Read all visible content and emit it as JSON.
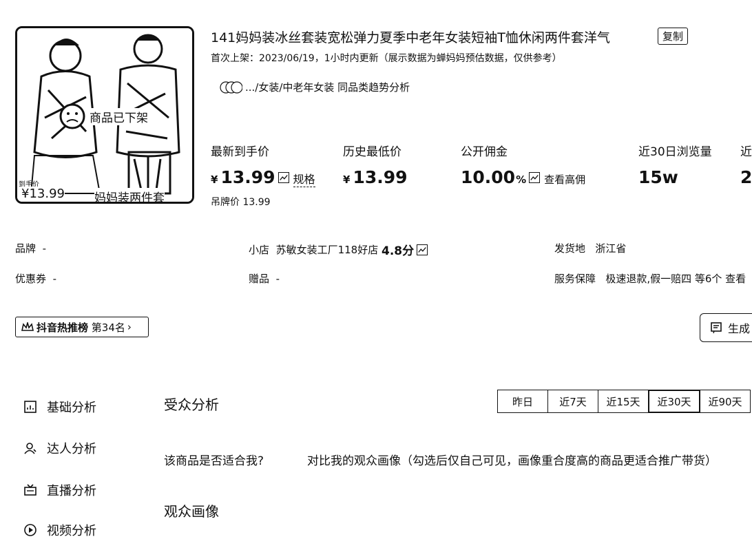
{
  "product": {
    "title": "141妈妈装冰丝套装宽松弹力夏季中老年女装短袖T恤休闲两件套洋气",
    "copy_label": "复制",
    "first_listed": "首次上架：2023/06/19，1小时内更新（展示数据为蝉妈妈预估数据，仅供参考）",
    "category": ".../女装/中老年女装 同品类趋势分析",
    "thumbnail": {
      "status_overlay": "商品已下架",
      "price_overlay": "¥13.99",
      "caption_overlay": "妈妈装两件套",
      "price_tag": "到手价"
    }
  },
  "stats": {
    "latest_price_label": "最新到手价",
    "latest_price_currency": "¥",
    "latest_price_value": "13.99",
    "spec_label": "规格",
    "tag_price": "吊牌价 13.99",
    "lowest_price_label": "历史最低价",
    "lowest_price_currency": "¥",
    "lowest_price_value": "13.99",
    "commission_label": "公开佣金",
    "commission_value": "10.00",
    "commission_unit": "%",
    "view_commission_label": "查看高佣",
    "views_label": "近30日浏览量",
    "views_value": "15w",
    "extra_label": "近",
    "extra_value": "2"
  },
  "info": {
    "brand_label": "品牌",
    "brand_value": "-",
    "shop_label": "小店",
    "shop_name": "苏敏女装工厂118好店",
    "shop_score": "4.8分",
    "ship_label": "发货地",
    "ship_value": "浙江省",
    "coupon_label": "优惠券",
    "coupon_value": "-",
    "gift_label": "赠品",
    "gift_value": "-",
    "service_label": "服务保障",
    "service_value": "极速退款,假一赔四 等6个 查看"
  },
  "rank": {
    "label": "抖音热推榜",
    "position": "第34名",
    "arrow": "›"
  },
  "generate_button": "生成",
  "sidebar": {
    "items": [
      {
        "label": "基础分析",
        "icon": "chart-icon"
      },
      {
        "label": "达人分析",
        "icon": "person-icon"
      },
      {
        "label": "直播分析",
        "icon": "tv-icon"
      },
      {
        "label": "视频分析",
        "icon": "video-icon"
      }
    ]
  },
  "audience": {
    "title": "受众分析",
    "tabs": [
      "昨日",
      "近7天",
      "近15天",
      "近30天",
      "近90天"
    ],
    "active_tab": "近30天",
    "question": "该商品是否适合我?",
    "compare_text": "对比我的观众画像（勾选后仅自己可见，画像重合度高的商品更适合推广带货）",
    "portrait_title": "观众画像"
  }
}
